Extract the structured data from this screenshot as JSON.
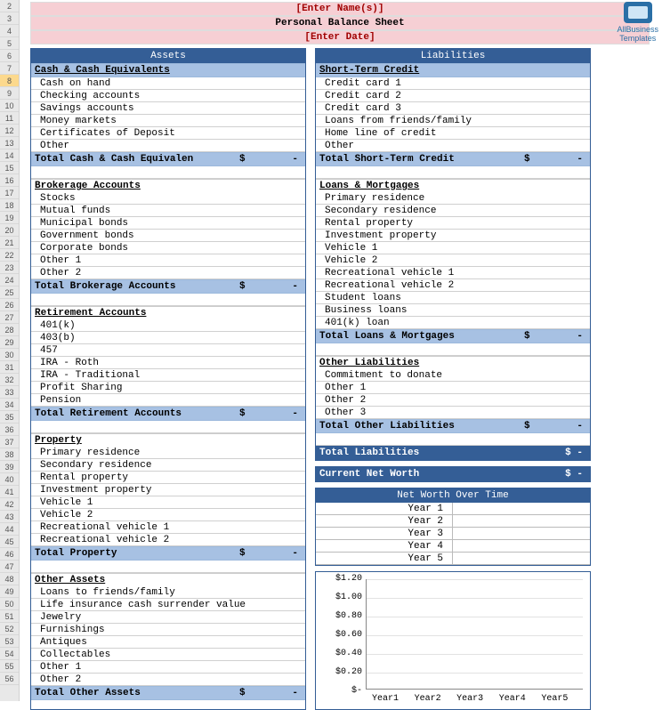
{
  "header": {
    "name_placeholder": "[Enter Name(s)]",
    "title": "Personal Balance Sheet",
    "date_placeholder": "[Enter Date]"
  },
  "columns": {
    "assets_title": "Assets",
    "liabilities_title": "Liabilities"
  },
  "assets": {
    "cash": {
      "head": "Cash & Cash Equivalents",
      "items": [
        "Cash on hand",
        "Checking accounts",
        "Savings accounts",
        "Money markets",
        "Certificates of Deposit",
        "Other"
      ],
      "total_label": "Total Cash & Cash Equivalen",
      "total_sym": "$",
      "total_val": "-"
    },
    "brokerage": {
      "head": "Brokerage Accounts",
      "items": [
        "Stocks",
        "Mutual funds",
        "Municipal bonds",
        "Government bonds",
        "Corporate bonds",
        "Other 1",
        "Other 2"
      ],
      "total_label": "Total Brokerage Accounts",
      "total_sym": "$",
      "total_val": "-"
    },
    "retirement": {
      "head": "Retirement Accounts",
      "items": [
        "401(k)",
        "403(b)",
        "457",
        "IRA - Roth",
        "IRA - Traditional",
        "Profit Sharing",
        "Pension"
      ],
      "total_label": "Total Retirement Accounts",
      "total_sym": "$",
      "total_val": "-"
    },
    "property": {
      "head": "Property",
      "items": [
        "Primary  residence",
        "Secondary residence",
        "Rental property",
        "Investment property",
        "Vehicle 1",
        "Vehicle 2",
        "Recreational vehicle 1",
        "Recreational vehicle 2"
      ],
      "total_label": "Total Property",
      "total_sym": "$",
      "total_val": "-"
    },
    "other": {
      "head": "Other Assets",
      "items": [
        "Loans to friends/family",
        "Life insurance cash surrender value",
        "Jewelry",
        "Furnishings",
        "Antiques",
        "Collectables",
        "Other 1",
        "Other 2"
      ],
      "total_label": "Total Other Assets",
      "total_sym": "$",
      "total_val": "-"
    }
  },
  "liabilities": {
    "short": {
      "head": "Short-Term Credit",
      "items": [
        "Credit card 1",
        "Credit card 2",
        "Credit card 3",
        "Loans from friends/family",
        "Home line of credit",
        "Other"
      ],
      "total_label": "Total Short-Term Credit",
      "total_sym": "$",
      "total_val": "-"
    },
    "loans": {
      "head": "Loans & Mortgages",
      "items": [
        "Primary  residence",
        "Secondary residence",
        "Rental property",
        "Investment property",
        "Vehicle 1",
        "Vehicle 2",
        "Recreational vehicle 1",
        "Recreational vehicle 2",
        "Student loans",
        "Business loans",
        "401(k) loan"
      ],
      "total_label": "Total Loans & Mortgages",
      "total_sym": "$",
      "total_val": "-"
    },
    "other": {
      "head": "Other Liabilities",
      "items": [
        "Commitment to donate",
        "Other 1",
        "Other 2",
        "Other 3"
      ],
      "total_label": "Total Other Liabilities",
      "total_sym": "$",
      "total_val": "-"
    },
    "grand_total_label": "Total Liabilities",
    "grand_total_sym": "$",
    "grand_total_val": "-"
  },
  "networth": {
    "current_label": "Current Net Worth",
    "current_sym": "$",
    "current_val": "-",
    "over_time_label": "Net Worth Over Time",
    "rows": [
      "Year 1",
      "Year 2",
      "Year 3",
      "Year 4",
      "Year 5"
    ]
  },
  "chart_data": {
    "type": "bar",
    "categories": [
      "Year1",
      "Year2",
      "Year3",
      "Year4",
      "Year5"
    ],
    "values": [
      null,
      null,
      null,
      null,
      null
    ],
    "yticks": [
      "$1.20",
      "$1.00",
      "$0.80",
      "$0.60",
      "$0.40",
      "$0.20",
      "$-"
    ],
    "xlabel": "",
    "ylabel": "",
    "ylim": [
      0,
      1.2
    ]
  },
  "logo": {
    "line1": "AllBusiness",
    "line2": "Templates"
  },
  "row_numbers": [
    2,
    3,
    4,
    5,
    6,
    7,
    8,
    9,
    10,
    11,
    12,
    13,
    14,
    15,
    16,
    17,
    18,
    19,
    20,
    21,
    22,
    23,
    24,
    25,
    26,
    27,
    28,
    29,
    30,
    31,
    32,
    33,
    34,
    35,
    36,
    37,
    38,
    39,
    40,
    41,
    42,
    43,
    44,
    45,
    46,
    47,
    48,
    49,
    50,
    51,
    52,
    53,
    54,
    55,
    56
  ],
  "selected_row": 8
}
